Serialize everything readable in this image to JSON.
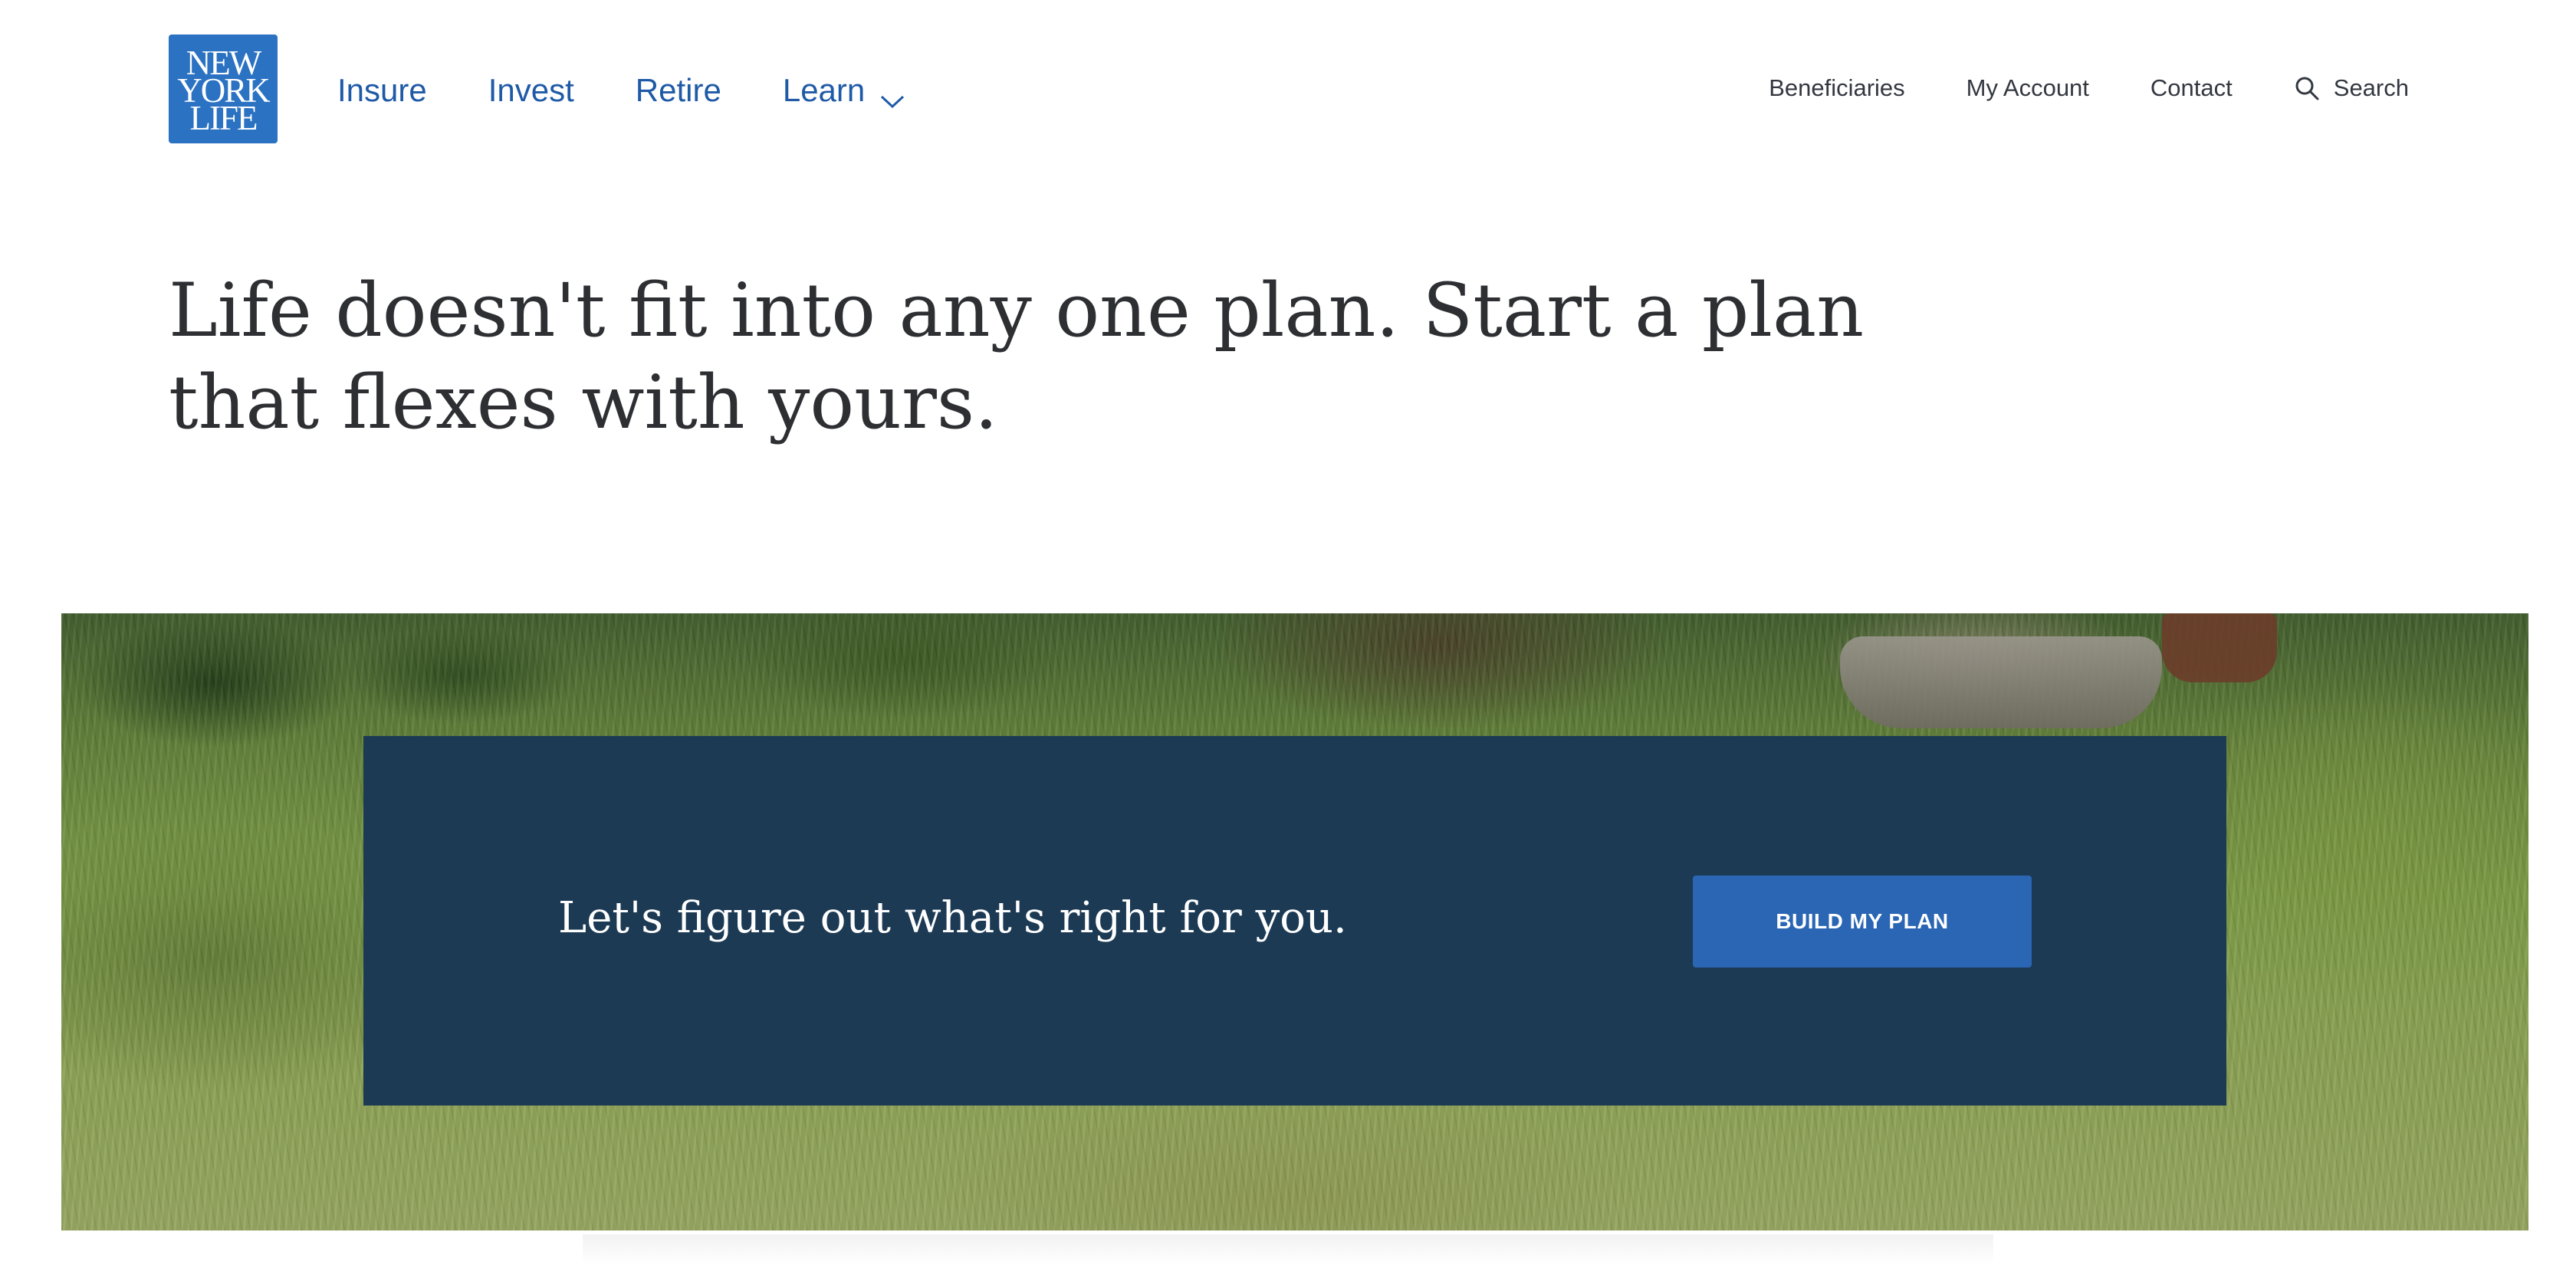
{
  "brand": {
    "logo_lines": [
      "NEW",
      "YORK",
      "LIFE"
    ],
    "color": "#2b72c2"
  },
  "primary_nav": {
    "items": [
      {
        "label": "Insure"
      },
      {
        "label": "Invest"
      },
      {
        "label": "Retire"
      },
      {
        "label": "Learn",
        "icon": "chevron-down-icon"
      }
    ]
  },
  "utility_nav": {
    "items": [
      {
        "label": "Beneficiaries"
      },
      {
        "label": "My Account"
      },
      {
        "label": "Contact"
      },
      {
        "label": "Search",
        "icon": "search-icon"
      }
    ]
  },
  "hero": {
    "headline": "Life doesn't fit into any one plan. Start a plan that flexes with yours.",
    "cta_text": "Let's figure out what's right for you.",
    "cta_button_label": "BUILD MY PLAN",
    "panel_color": "#1c3a54",
    "button_color": "#2a66b4"
  }
}
